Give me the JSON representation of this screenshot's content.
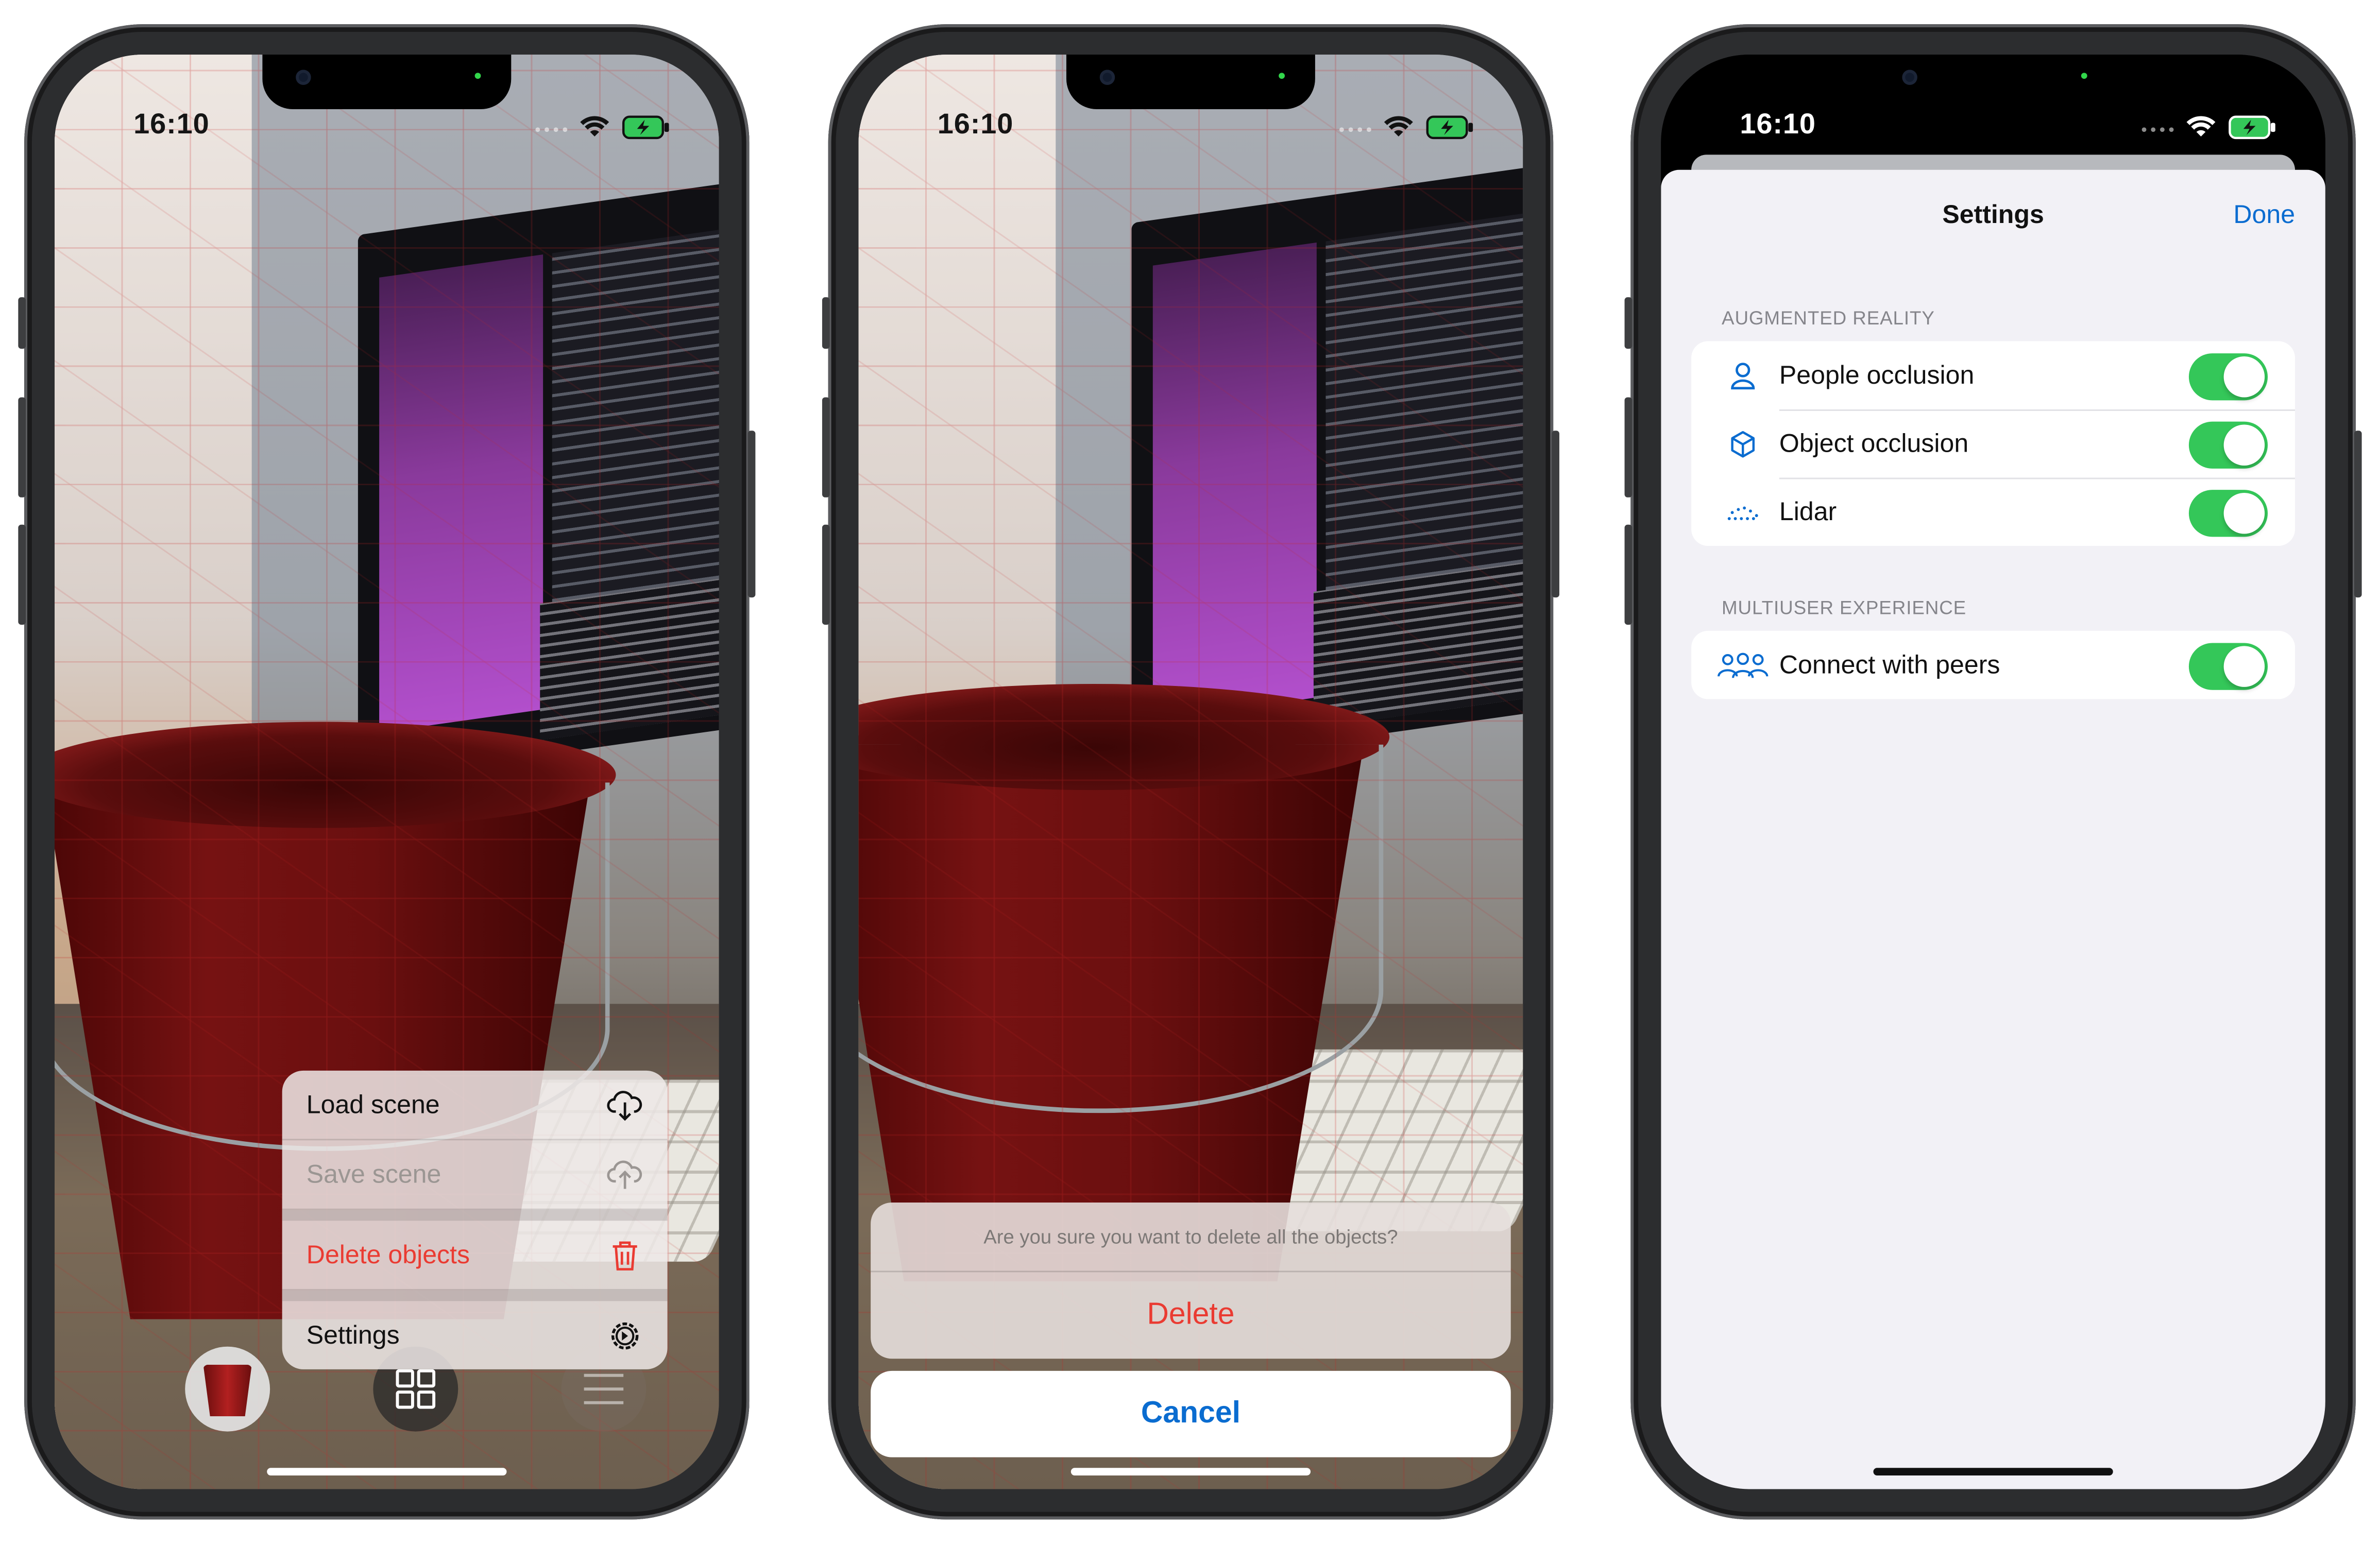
{
  "status_bar": {
    "time": "16:10"
  },
  "phone1": {
    "menu": {
      "load_scene": "Load scene",
      "save_scene": "Save scene",
      "delete_objects": "Delete objects",
      "settings": "Settings"
    },
    "toolbar": {
      "bucket_icon": "red-bucket-icon",
      "grid_icon": "grid-icon",
      "sliders_icon": "sliders-icon"
    }
  },
  "phone2": {
    "dialog": {
      "message": "Are you sure you want to delete all the objects?",
      "delete_label": "Delete",
      "cancel_label": "Cancel"
    }
  },
  "phone3": {
    "nav": {
      "title": "Settings",
      "done_label": "Done"
    },
    "sections": [
      {
        "header": "AUGMENTED REALITY",
        "rows": [
          {
            "label": "People occlusion",
            "icon": "person-icon",
            "on": true
          },
          {
            "label": "Object occlusion",
            "icon": "cube-icon",
            "on": true
          },
          {
            "label": "Lidar",
            "icon": "lidar-dots-icon",
            "on": true
          }
        ]
      },
      {
        "header": "MULTIUSER EXPERIENCE",
        "rows": [
          {
            "label": "Connect with peers",
            "icon": "people-group-icon",
            "on": true
          }
        ]
      }
    ]
  },
  "colors": {
    "accent_blue": "#0a6cd0",
    "destructive_red": "#ea3b32",
    "toggle_green": "#34c759"
  }
}
